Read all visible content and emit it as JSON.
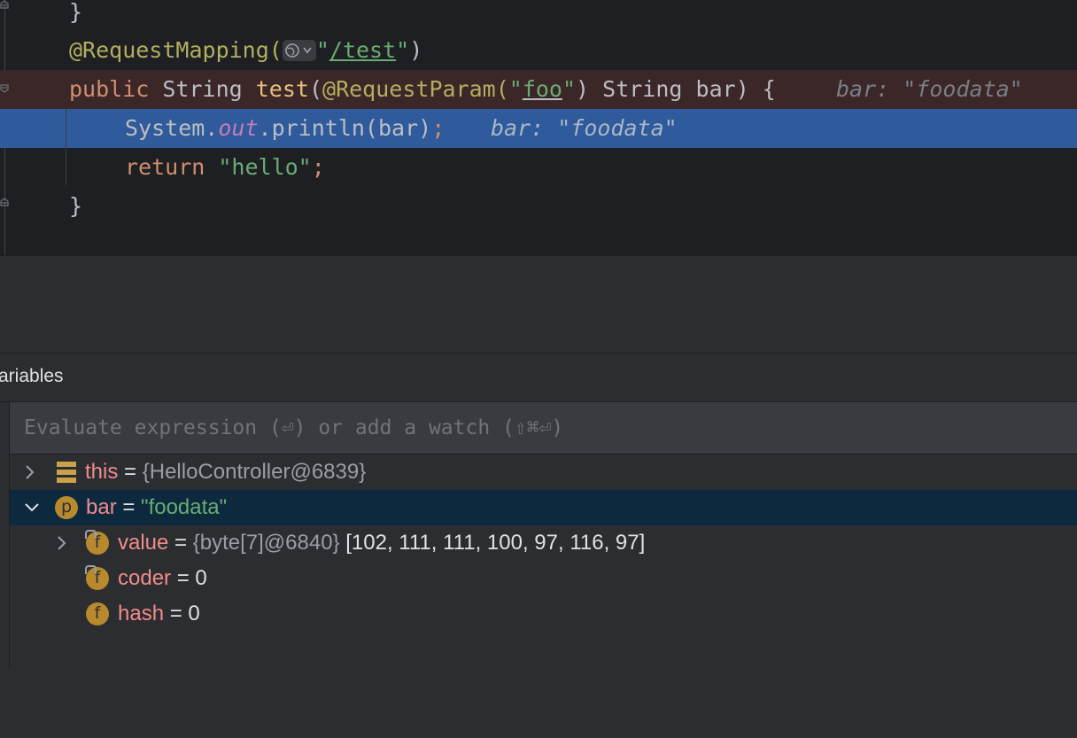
{
  "editor": {
    "line0": {
      "brace": "}"
    },
    "line1": {
      "annotation": "@RequestMapping(",
      "path": "/test",
      "close": ")"
    },
    "line2": {
      "kw_public": "public",
      "type_string": "String",
      "method": "test",
      "annotation": "@RequestParam(",
      "param_name": "foo",
      "close_paren": ")",
      "param_type": "String",
      "param_var": "bar",
      "tail": ") {",
      "hint": "bar: \"foodata\""
    },
    "line3": {
      "system": "System.",
      "out": "out",
      "println": ".println(bar)",
      "semi": ";",
      "hint": "bar: \"foodata\""
    },
    "line4": {
      "kw_return": "return",
      "value": "\"hello\"",
      "semi": ";"
    },
    "line5": {
      "brace": "}"
    }
  },
  "debugger": {
    "variables_title": "ariables",
    "evaluate_placeholder": "Evaluate expression (⏎) or add a watch (⇧⌘⏎)",
    "variables": [
      {
        "name": "this",
        "eq": " = ",
        "ref": "{HelloController@6839}",
        "extra": "",
        "icon": "stack-icon",
        "expanded": false
      },
      {
        "name": "bar",
        "eq": " = ",
        "ref": "",
        "extra": "\"foodata\"",
        "icon": "p",
        "expanded": true
      },
      {
        "name": "value",
        "eq": " = ",
        "ref": "{byte[7]@6840}",
        "extra": " [102, 111, 111, 100, 97, 116, 97]",
        "icon": "f",
        "expanded": false
      },
      {
        "name": "coder",
        "eq": " = ",
        "ref": "",
        "extra": "0",
        "icon": "f",
        "expanded": null
      },
      {
        "name": "hash",
        "eq": " = ",
        "ref": "",
        "extra": "0",
        "icon": "f",
        "expanded": null
      }
    ]
  },
  "colors": {
    "current_line": "#2f5a9c",
    "breakpoint_line": "#3b2628",
    "selected_row": "#0d293e"
  }
}
